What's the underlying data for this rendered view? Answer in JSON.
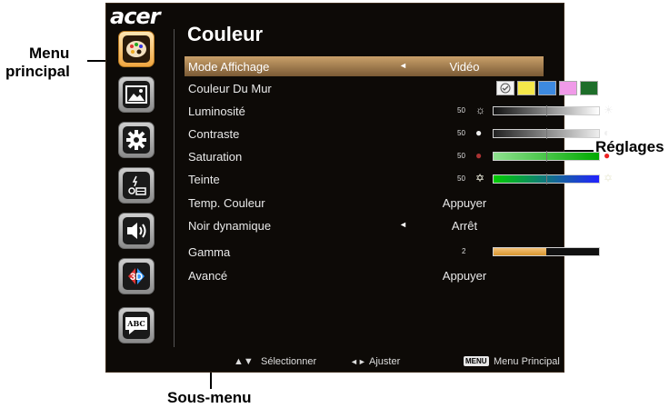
{
  "callouts": {
    "main_menu_line1": "Menu",
    "main_menu_line2": "principal",
    "settings": "Réglages",
    "submenu": "Sous-menu"
  },
  "osd": {
    "logo": "acer",
    "title": "Couleur",
    "sidebar_icons": [
      "palette-icon",
      "image-icon",
      "gear-icon",
      "projector-icon",
      "speaker-icon",
      "3d-icon",
      "subtitle-abc-icon"
    ],
    "rows": [
      {
        "label": "Mode Affichage",
        "value": "Vidéo",
        "left_arrow": "◄",
        "right_arrow": "►"
      },
      {
        "label": "Couleur Du Mur"
      },
      {
        "label": "Luminosité",
        "level": "50"
      },
      {
        "label": "Contraste",
        "level": "50"
      },
      {
        "label": "Saturation",
        "level": "50"
      },
      {
        "label": "Teinte",
        "level": "50"
      },
      {
        "label": "Temp. Couleur",
        "value": "Appuyer",
        "right_arrow": "►"
      },
      {
        "label": "Noir dynamique",
        "value": "Arrêt",
        "left_arrow": "◄",
        "right_arrow": "►"
      },
      {
        "label": "Gamma",
        "level": "2"
      },
      {
        "label": "Avancé",
        "value": "Appuyer",
        "right_arrow": "►"
      }
    ],
    "wall_colors": [
      "#f2f2f2",
      "#f5e84a",
      "#3d8ae0",
      "#f09ae8",
      "#1e6e2a"
    ],
    "gamma_fill": 0.5,
    "footer": {
      "select_keys": "▲▼",
      "select": "Sélectionner",
      "adjust_keys": "◄►",
      "adjust": "Ajuster",
      "menu_key": "MENU",
      "main_menu": "Menu Principal"
    }
  }
}
